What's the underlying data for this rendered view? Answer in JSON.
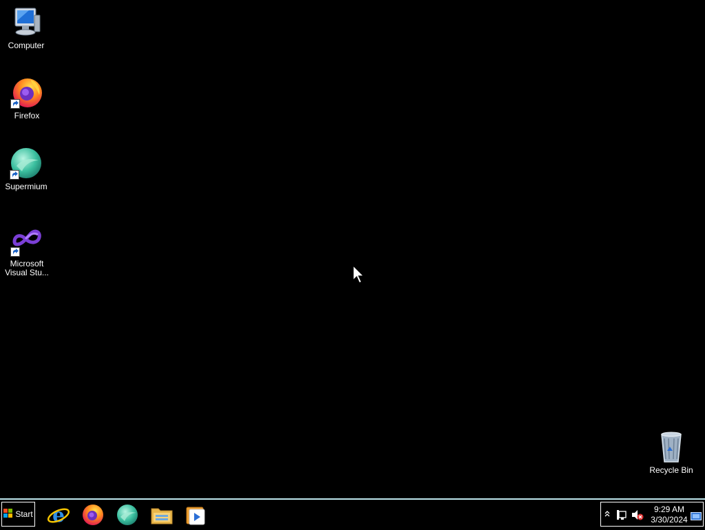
{
  "desktop": {
    "icons": [
      {
        "label": "Computer",
        "icon": "computer-icon",
        "shortcut": false
      },
      {
        "label": "Firefox",
        "icon": "firefox-icon",
        "shortcut": true
      },
      {
        "label": "Supermium",
        "icon": "supermium-icon",
        "shortcut": true
      },
      {
        "label": "Microsoft\nVisual Stu...",
        "icon": "visual-studio-icon",
        "shortcut": true
      },
      {
        "label": "Recycle Bin",
        "icon": "recycle-bin-icon",
        "shortcut": false
      }
    ]
  },
  "taskbar": {
    "start_label": "Start",
    "pinned": [
      {
        "name": "Internet Explorer",
        "icon": "internet-explorer-icon"
      },
      {
        "name": "Firefox",
        "icon": "firefox-icon"
      },
      {
        "name": "Supermium",
        "icon": "supermium-icon"
      },
      {
        "name": "File Explorer",
        "icon": "folder-icon"
      },
      {
        "name": "Media Player",
        "icon": "media-player-icon"
      }
    ],
    "tray": {
      "time": "9:29 AM",
      "date": "3/30/2024",
      "icons": [
        "chevron-up-icon",
        "network-icon",
        "volume-muted-icon",
        "show-desktop-icon"
      ]
    }
  },
  "colors": {
    "desktop_background": "#000000",
    "taskbar_border": "#bfe8ef"
  }
}
